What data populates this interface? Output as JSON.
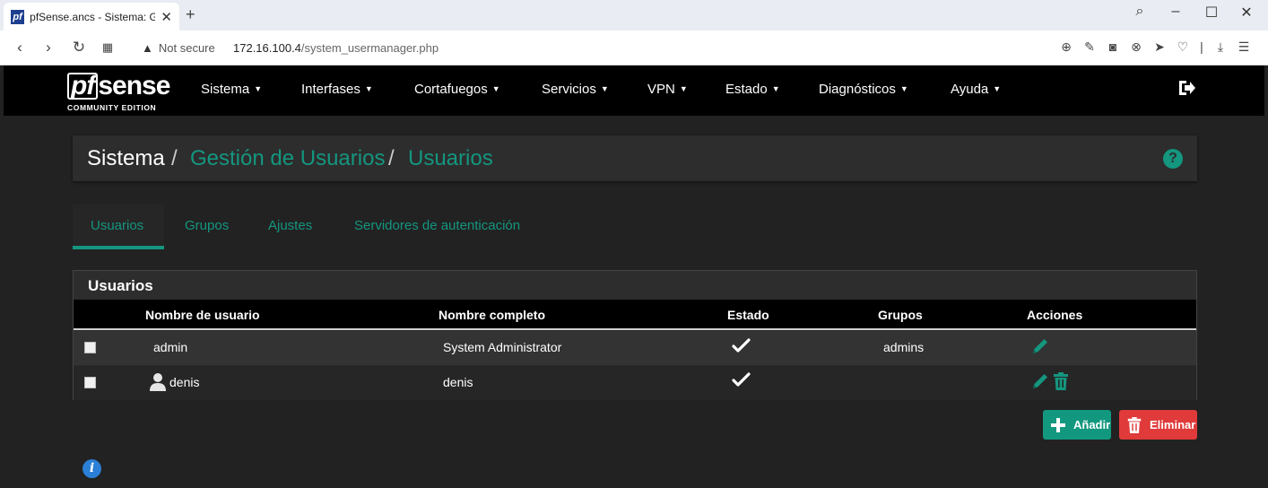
{
  "browser": {
    "tab_title": "pfSense.ancs - Sistema: Gestión",
    "favicon_text": "pf",
    "new_tab": "+",
    "security_label": "Not secure",
    "url_host": "172.16.100.4",
    "url_path": "/system_usermanager.php"
  },
  "logo": {
    "brand_main": "sense",
    "brand_pf": "pf",
    "edition": "COMMUNITY EDITION"
  },
  "nav": {
    "items": [
      {
        "label": "Sistema"
      },
      {
        "label": "Interfases"
      },
      {
        "label": "Cortafuegos"
      },
      {
        "label": "Servicios"
      },
      {
        "label": "VPN"
      },
      {
        "label": "Estado"
      },
      {
        "label": "Diagnósticos"
      },
      {
        "label": "Ayuda"
      }
    ]
  },
  "breadcrumb": {
    "root": "Sistema",
    "sep": "/",
    "level1": "Gestión de Usuarios",
    "level2": "Usuarios",
    "help_symbol": "?"
  },
  "tabs": [
    {
      "label": "Usuarios",
      "active": true
    },
    {
      "label": "Grupos",
      "active": false
    },
    {
      "label": "Ajustes",
      "active": false
    },
    {
      "label": "Servidores de autenticación",
      "active": false
    }
  ],
  "panel": {
    "title": "Usuarios",
    "columns": [
      "Nombre de usuario",
      "Nombre completo",
      "Estado",
      "Grupos",
      "Acciones"
    ],
    "rows": [
      {
        "username": "admin",
        "fullname": "System Administrator",
        "enabled": true,
        "groups": "admins",
        "actions": [
          "edit"
        ]
      },
      {
        "username": "denis",
        "fullname": "denis",
        "enabled": true,
        "groups": "",
        "actions": [
          "edit",
          "delete"
        ]
      }
    ]
  },
  "buttons": {
    "add": "Añadir",
    "delete": "Eliminar"
  },
  "info_symbol": "i",
  "colors": {
    "accent": "#14967f",
    "danger": "#e03a3a",
    "navbar": "#000000",
    "background": "#222222"
  }
}
